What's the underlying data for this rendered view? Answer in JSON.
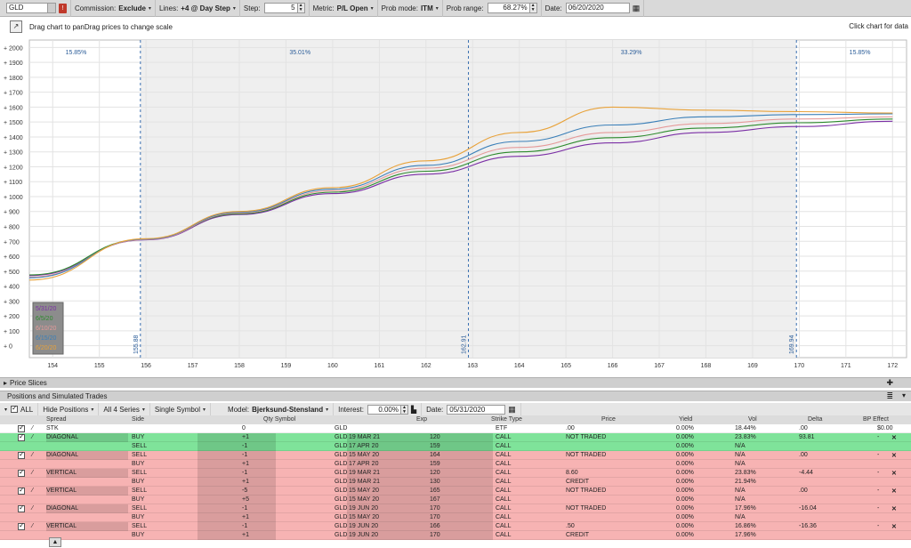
{
  "toolbar": {
    "symbol": "GLD",
    "alert_badge": "!",
    "commission_label": "Commission:",
    "commission_value": "Exclude",
    "lines_label": "Lines:",
    "lines_value": "+4 @ Day Step",
    "step_label": "Step:",
    "step_value": "5",
    "metric_label": "Metric:",
    "metric_value": "P/L Open",
    "prob_mode_label": "Prob mode:",
    "prob_mode_value": "ITM",
    "prob_range_label": "Prob range:",
    "prob_range_value": "68.27%",
    "date_label": "Date:",
    "date_value": "06/20/2020"
  },
  "hint": {
    "left_text": "Drag chart to panDrag prices to change scale",
    "right_text": "Click chart for data"
  },
  "chart_data": {
    "type": "line",
    "x_ticks": [
      154,
      155,
      156,
      157,
      158,
      159,
      160,
      161,
      162,
      163,
      164,
      165,
      166,
      167,
      168,
      169,
      170,
      171,
      172
    ],
    "y_ticks": [
      "+ 0",
      "+ 100",
      "+ 200",
      "+ 300",
      "+ 400",
      "+ 500",
      "+ 600",
      "+ 700",
      "+ 800",
      "+ 900",
      "+ 1000",
      "+ 1100",
      "+ 1200",
      "+ 1300",
      "+ 1400",
      "+ 1500",
      "+ 1600",
      "+ 1700",
      "+ 1800",
      "+ 1900",
      "+ 2000"
    ],
    "xlim": [
      153.5,
      172.3
    ],
    "ylim": [
      -80,
      2050
    ],
    "prob_labels": [
      {
        "text": "15.85%",
        "x": 154.5
      },
      {
        "text": "35.01%",
        "x": 159.3
      },
      {
        "text": "33.29%",
        "x": 166.4
      },
      {
        "text": "15.85%",
        "x": 171.3
      }
    ],
    "vlines": [
      {
        "x": 155.88,
        "label": "155.88"
      },
      {
        "x": 162.91,
        "label": "162.91"
      },
      {
        "x": 169.94,
        "label": "169.94"
      }
    ],
    "series": [
      {
        "name": "5/31/20",
        "color": "#7b2fa5",
        "x": [
          153.5,
          156,
          158,
          160,
          162,
          164,
          166,
          168,
          170,
          172
        ],
        "y": [
          470,
          710,
          880,
          1020,
          1150,
          1270,
          1360,
          1430,
          1470,
          1505
        ]
      },
      {
        "name": "6/5/20",
        "color": "#2d8a2d",
        "x": [
          153.5,
          156,
          158,
          160,
          162,
          164,
          166,
          168,
          170,
          172
        ],
        "y": [
          475,
          715,
          885,
          1030,
          1170,
          1300,
          1395,
          1460,
          1495,
          1520
        ]
      },
      {
        "name": "6/10/20",
        "color": "#e59a9a",
        "x": [
          153.5,
          156,
          158,
          160,
          162,
          164,
          166,
          168,
          170,
          172
        ],
        "y": [
          460,
          712,
          890,
          1040,
          1190,
          1330,
          1430,
          1490,
          1520,
          1535
        ]
      },
      {
        "name": "6/15/20",
        "color": "#3a7fb8",
        "x": [
          153.5,
          156,
          158,
          160,
          162,
          164,
          166,
          168,
          170,
          172
        ],
        "y": [
          455,
          715,
          895,
          1050,
          1210,
          1370,
          1480,
          1535,
          1550,
          1555
        ]
      },
      {
        "name": "6/20/20",
        "color": "#e8a23a",
        "x": [
          153.5,
          156,
          158,
          160,
          162,
          164,
          166,
          168,
          170,
          172
        ],
        "y": [
          440,
          718,
          900,
          1060,
          1240,
          1430,
          1600,
          1580,
          1570,
          1560
        ]
      }
    ],
    "grid": true,
    "legend_placement": "bottom-left"
  },
  "sections": {
    "price_slices": "Price Slices",
    "positions": "Positions and Simulated Trades"
  },
  "pos_toolbar": {
    "all": "ALL",
    "hide_positions": "Hide Positions",
    "all_series": "All 4 Series",
    "single_symbol": "Single Symbol",
    "model_label": "Model:",
    "model_value": "Bjerksund-Stensland",
    "interest_label": "Interest:",
    "interest_value": "0.00%",
    "date_label": "Date:",
    "date_value": "05/31/2020"
  },
  "columns": [
    "Spread",
    "Side",
    "Qty Symbol",
    "Exp",
    "Strike Type",
    "Price",
    "Yield",
    "Vol",
    "Delta",
    "BP Effect"
  ],
  "rows": [
    {
      "spread": "STK",
      "side": "",
      "qty": "0",
      "sym": "GLD",
      "exp": "",
      "strike": "",
      "type": "ETF",
      "price": ".00",
      "yield": "0.00%",
      "vol": "18.44%",
      "delta": ".00",
      "bp": "$0.00",
      "bg": "#ffffff"
    },
    {
      "spread": "DIAGONAL",
      "side": "BUY",
      "qty": "+1",
      "sym": "GLD",
      "exp": "19 MAR 21",
      "strike": "120",
      "type": "CALL",
      "price": "NOT TRADED",
      "yield": "0.00%",
      "vol": "23.83%",
      "delta": "93.81",
      "bp": "-",
      "bg": "#7fe39a"
    },
    {
      "spread": "",
      "side": "SELL",
      "qty": "-1",
      "sym": "GLD",
      "exp": "17 APR 20",
      "strike": "159",
      "type": "CALL",
      "price": "",
      "yield": "0.00%",
      "vol": "N/A",
      "delta": "",
      "bp": "",
      "bg": "#7fe39a"
    },
    {
      "spread": "DIAGONAL",
      "side": "SELL",
      "qty": "-1",
      "sym": "GLD",
      "exp": "15 MAY 20",
      "strike": "164",
      "type": "CALL",
      "price": "NOT TRADED",
      "yield": "0.00%",
      "vol": "N/A",
      "delta": ".00",
      "bp": "-",
      "bg": "#f7b3b3"
    },
    {
      "spread": "",
      "side": "BUY",
      "qty": "+1",
      "sym": "GLD",
      "exp": "17 APR 20",
      "strike": "159",
      "type": "CALL",
      "price": "",
      "yield": "0.00%",
      "vol": "N/A",
      "delta": "",
      "bp": "",
      "bg": "#f7b3b3"
    },
    {
      "spread": "VERTICAL",
      "side": "SELL",
      "qty": "-1",
      "sym": "GLD",
      "exp": "19 MAR 21",
      "strike": "120",
      "type": "CALL",
      "price": "8.60",
      "yield": "0.00%",
      "vol": "23.83%",
      "delta": "-4.44",
      "bp": "-",
      "bg": "#f7b3b3"
    },
    {
      "spread": "",
      "side": "BUY",
      "qty": "+1",
      "sym": "GLD",
      "exp": "19 MAR 21",
      "strike": "130",
      "type": "CALL",
      "price": "CREDIT",
      "yield": "0.00%",
      "vol": "21.94%",
      "delta": "",
      "bp": "",
      "bg": "#f7b3b3"
    },
    {
      "spread": "VERTICAL",
      "side": "SELL",
      "qty": "-5",
      "sym": "GLD",
      "exp": "15 MAY 20",
      "strike": "165",
      "type": "CALL",
      "price": "NOT TRADED",
      "yield": "0.00%",
      "vol": "N/A",
      "delta": ".00",
      "bp": "-",
      "bg": "#f7b3b3"
    },
    {
      "spread": "",
      "side": "BUY",
      "qty": "+5",
      "sym": "GLD",
      "exp": "15 MAY 20",
      "strike": "167",
      "type": "CALL",
      "price": "",
      "yield": "0.00%",
      "vol": "N/A",
      "delta": "",
      "bp": "",
      "bg": "#f7b3b3"
    },
    {
      "spread": "DIAGONAL",
      "side": "SELL",
      "qty": "-1",
      "sym": "GLD",
      "exp": "19 JUN 20",
      "strike": "170",
      "type": "CALL",
      "price": "NOT TRADED",
      "yield": "0.00%",
      "vol": "17.96%",
      "delta": "-16.04",
      "bp": "-",
      "bg": "#f7b3b3"
    },
    {
      "spread": "",
      "side": "BUY",
      "qty": "+1",
      "sym": "GLD",
      "exp": "15 MAY 20",
      "strike": "170",
      "type": "CALL",
      "price": "",
      "yield": "0.00%",
      "vol": "N/A",
      "delta": "",
      "bp": "",
      "bg": "#f7b3b3"
    },
    {
      "spread": "VERTICAL",
      "side": "SELL",
      "qty": "-1",
      "sym": "GLD",
      "exp": "19 JUN 20",
      "strike": "166",
      "type": "CALL",
      "price": ".50",
      "yield": "0.00%",
      "vol": "16.86%",
      "delta": "-16.36",
      "bp": "-",
      "bg": "#f7b3b3"
    },
    {
      "spread": "",
      "side": "BUY",
      "qty": "+1",
      "sym": "GLD",
      "exp": "19 JUN 20",
      "strike": "170",
      "type": "CALL",
      "price": "CREDIT",
      "yield": "0.00%",
      "vol": "17.96%",
      "delta": "",
      "bp": "",
      "bg": "#f7b3b3"
    }
  ]
}
